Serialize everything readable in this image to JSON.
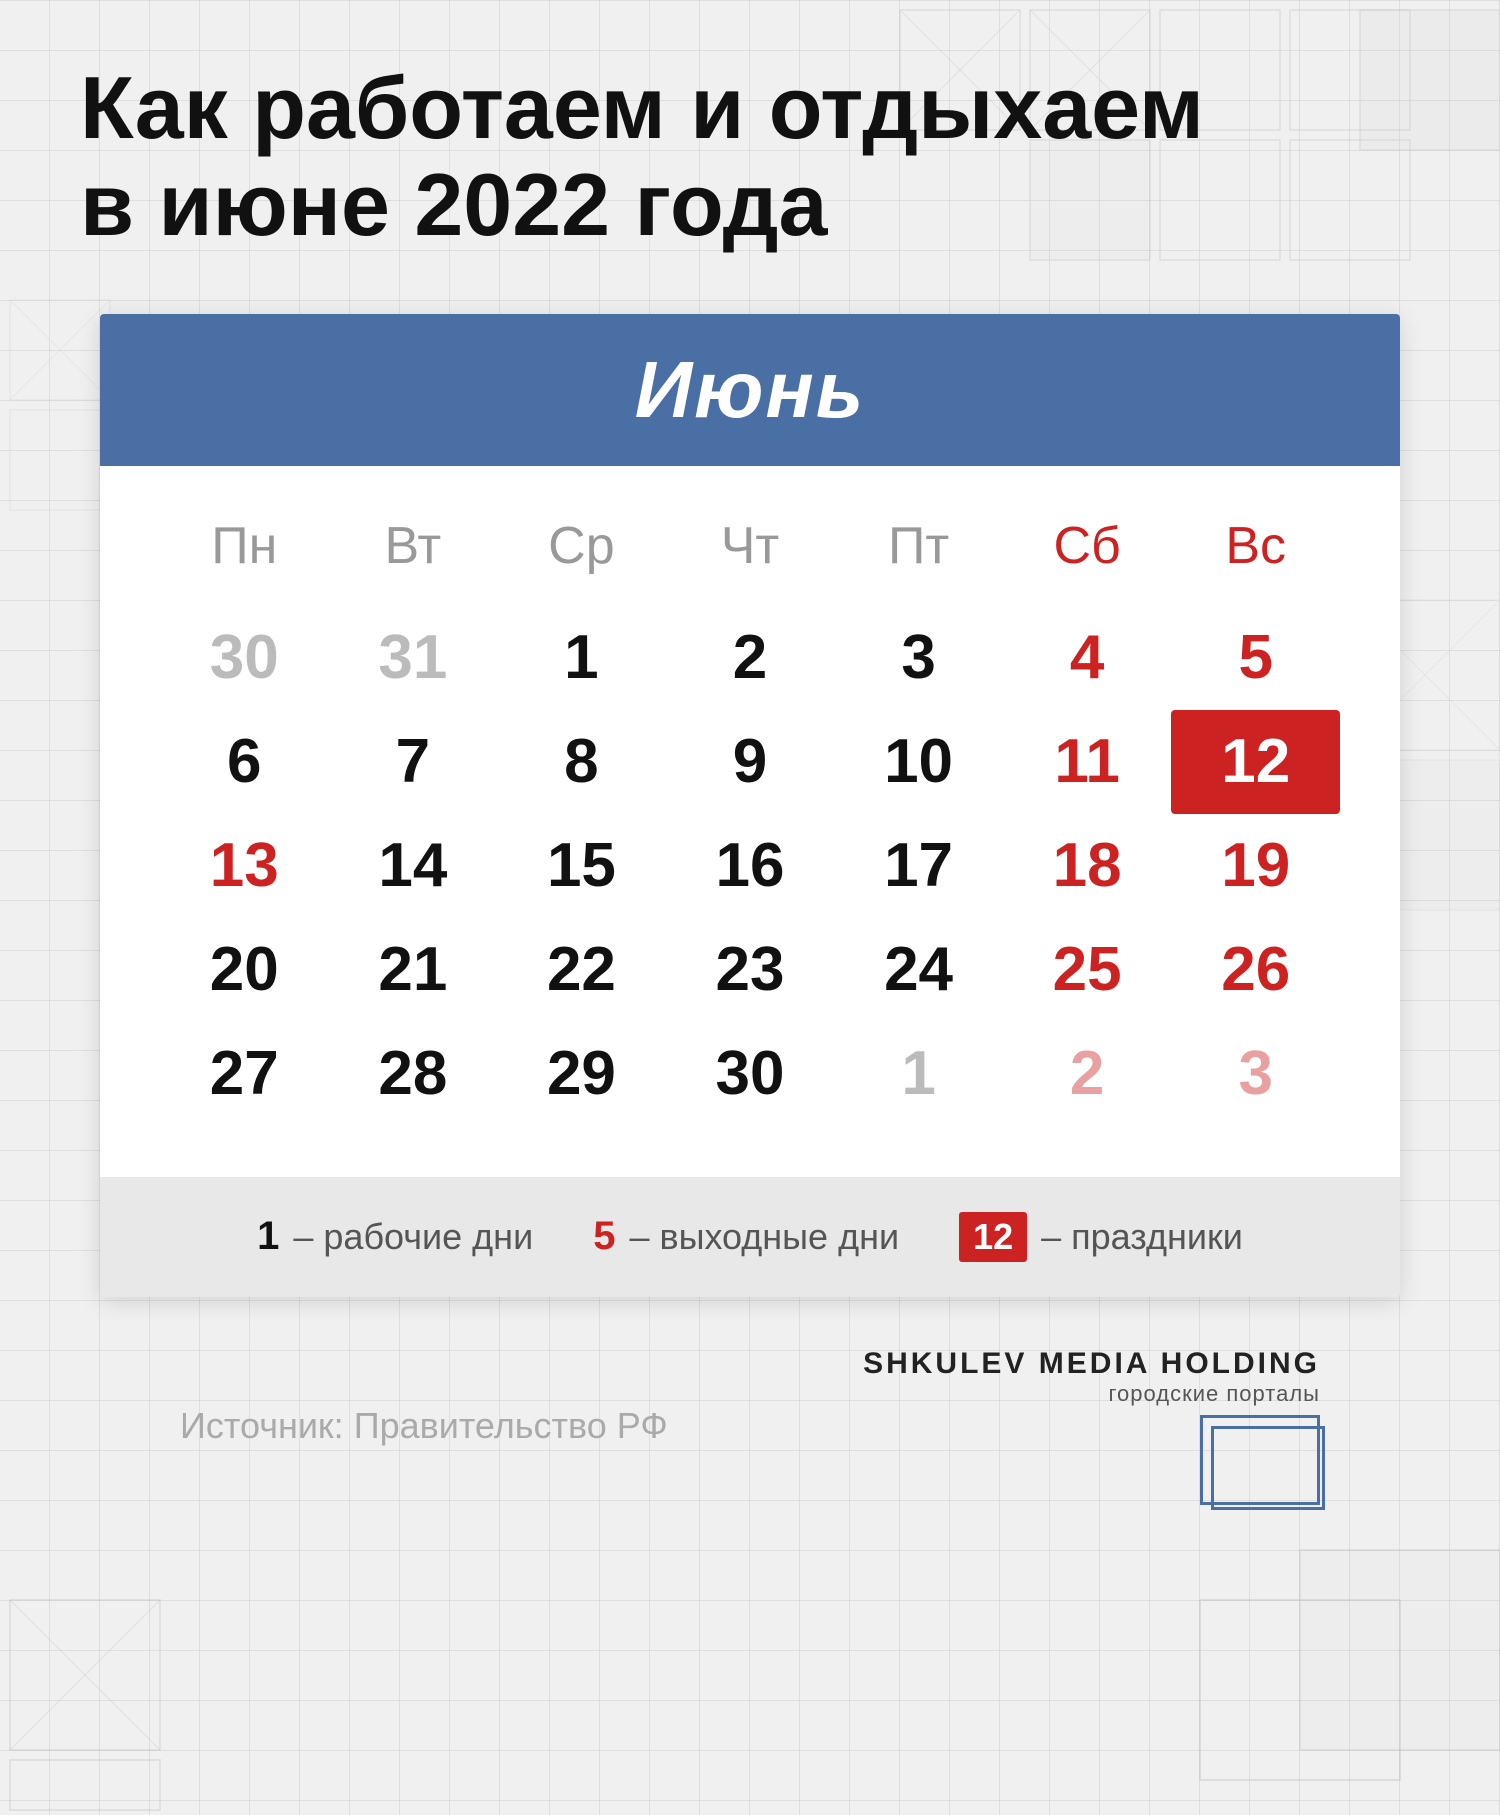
{
  "title": {
    "line1": "Как работаем и отдыхаем",
    "line2": "в июне 2022 года"
  },
  "calendar": {
    "month": "Июнь",
    "headers": [
      {
        "label": "Пн",
        "type": "weekday"
      },
      {
        "label": "Вт",
        "type": "weekday"
      },
      {
        "label": "Ср",
        "type": "weekday"
      },
      {
        "label": "Чт",
        "type": "weekday"
      },
      {
        "label": "Пт",
        "type": "weekday"
      },
      {
        "label": "Сб",
        "type": "weekend"
      },
      {
        "label": "Вс",
        "type": "weekend"
      }
    ],
    "days": [
      {
        "text": "30",
        "type": "faded"
      },
      {
        "text": "31",
        "type": "faded"
      },
      {
        "text": "1",
        "type": "normal"
      },
      {
        "text": "2",
        "type": "normal"
      },
      {
        "text": "3",
        "type": "normal"
      },
      {
        "text": "4",
        "type": "weekend-day"
      },
      {
        "text": "5",
        "type": "weekend-day"
      },
      {
        "text": "6",
        "type": "normal"
      },
      {
        "text": "7",
        "type": "normal"
      },
      {
        "text": "8",
        "type": "normal"
      },
      {
        "text": "9",
        "type": "normal"
      },
      {
        "text": "10",
        "type": "normal"
      },
      {
        "text": "11",
        "type": "weekend-day"
      },
      {
        "text": "12",
        "type": "holiday"
      },
      {
        "text": "13",
        "type": "special-red"
      },
      {
        "text": "14",
        "type": "normal"
      },
      {
        "text": "15",
        "type": "normal"
      },
      {
        "text": "16",
        "type": "normal"
      },
      {
        "text": "17",
        "type": "normal"
      },
      {
        "text": "18",
        "type": "weekend-day"
      },
      {
        "text": "19",
        "type": "weekend-day"
      },
      {
        "text": "20",
        "type": "normal"
      },
      {
        "text": "21",
        "type": "normal"
      },
      {
        "text": "22",
        "type": "normal"
      },
      {
        "text": "23",
        "type": "normal"
      },
      {
        "text": "24",
        "type": "normal"
      },
      {
        "text": "25",
        "type": "weekend-day"
      },
      {
        "text": "26",
        "type": "weekend-day"
      },
      {
        "text": "27",
        "type": "normal"
      },
      {
        "text": "28",
        "type": "normal"
      },
      {
        "text": "29",
        "type": "normal"
      },
      {
        "text": "30",
        "type": "normal"
      },
      {
        "text": "1",
        "type": "faded"
      },
      {
        "text": "2",
        "type": "faded-red"
      },
      {
        "text": "3",
        "type": "faded-red"
      }
    ]
  },
  "legend": {
    "item1_num": "1",
    "item1_text": "– рабочие дни",
    "item2_num": "5",
    "item2_text": "– выходные дни",
    "item3_num": "12",
    "item3_text": "– праздники"
  },
  "footer": {
    "source": "Источник: Правительство РФ",
    "brand_name": "SHKULEV MEDIA HOLDING",
    "brand_sub": "городские порталы"
  }
}
